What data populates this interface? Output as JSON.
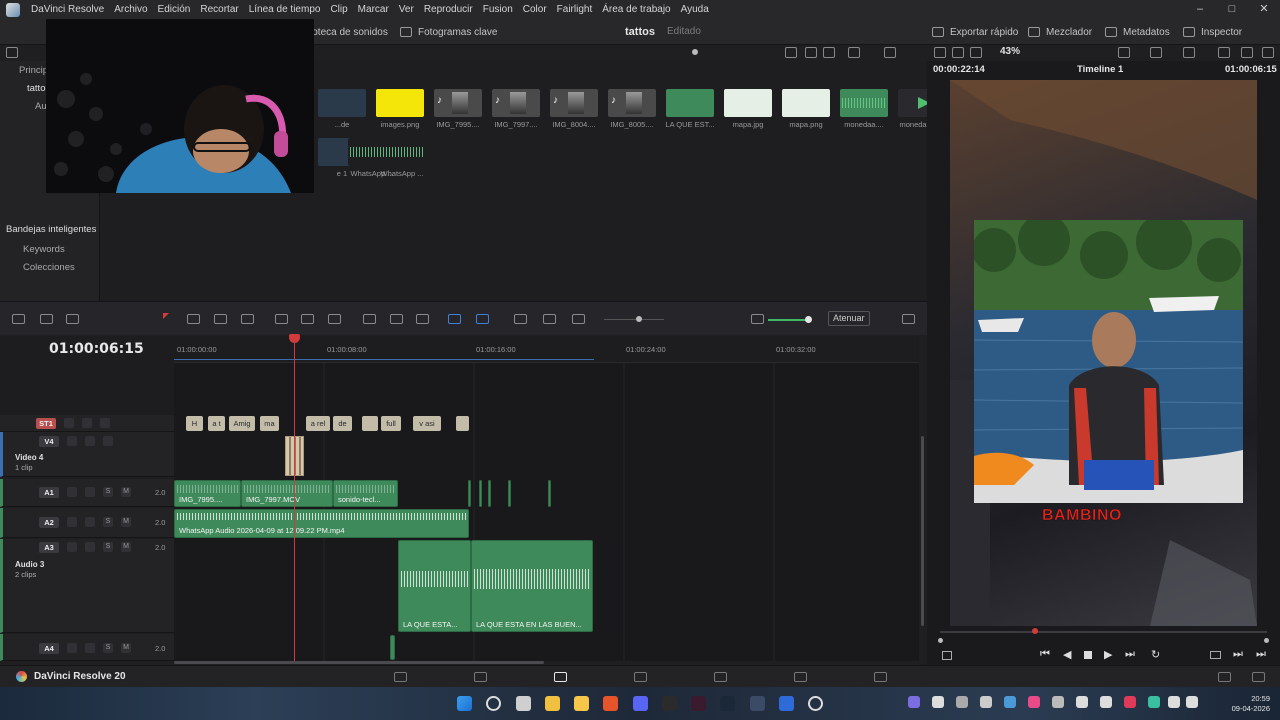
{
  "app": {
    "title": "DaVinci Resolve",
    "brand_footer": "DaVinci Resolve 20"
  },
  "menu": [
    "Archivo",
    "Edición",
    "Recortar",
    "Línea de tiempo",
    "Clip",
    "Marcar",
    "Ver",
    "Reproducir",
    "Fusion",
    "Color",
    "Fairlight",
    "Área de trabajo",
    "Ayuda"
  ],
  "toolbar": {
    "sound_library": "iblioteca de sonidos",
    "keyframes": "Fotogramas clave",
    "project_name": "tattos",
    "project_state": "Editado",
    "quick_export": "Exportar rápido",
    "mixer": "Mezclador",
    "metadata": "Metadatos",
    "inspector": "Inspector"
  },
  "viewer": {
    "zoom": "43%",
    "source_tc": "00:00:22:14",
    "timeline_name": "Timeline 1",
    "record_tc": "01:00:06:15",
    "overlay_text": "BAMBINO"
  },
  "media_left": {
    "principal": "Princip",
    "tattos": "tatto",
    "audio": "Au",
    "smart_bins": "Bandejas inteligentes",
    "keywords": "Keywords",
    "collections": "Colecciones"
  },
  "media_pool": {
    "row1": [
      {
        "label": "...de",
        "kind": "video"
      },
      {
        "label": "images.png",
        "kind": "yellow"
      },
      {
        "label": "IMG_7995....",
        "kind": "img"
      },
      {
        "label": "IMG_7997....",
        "kind": "img"
      },
      {
        "label": "IMG_8004....",
        "kind": "img"
      },
      {
        "label": "IMG_8005....",
        "kind": "img"
      },
      {
        "label": "LA QUE EST...",
        "kind": "green"
      },
      {
        "label": "mapa.jpg",
        "kind": "map"
      },
      {
        "label": "mapa.png",
        "kind": "map"
      },
      {
        "label": "monedaa....",
        "kind": "audio"
      },
      {
        "label": "moneda-fw....",
        "kind": "play"
      }
    ],
    "row2": [
      {
        "label": "e 1",
        "kind": "video"
      },
      {
        "label": "WhatsApp ...",
        "kind": "wave"
      },
      {
        "label": "WhatsApp ...",
        "kind": "wave"
      }
    ]
  },
  "timeline": {
    "timecode": "01:00:06:15",
    "attenuate_label": "Atenuar",
    "ruler": [
      "01:00:00:00",
      "01:00:08:00",
      "01:00:16:00",
      "01:00:24:00",
      "01:00:32:00"
    ],
    "subtitles": [
      "H",
      "a t",
      "Amig",
      "ma",
      "a rel",
      "de",
      "",
      "full",
      "v asi",
      ""
    ],
    "tracks": {
      "st1": "ST1",
      "v4": {
        "tag": "V4",
        "name": "Video 4",
        "clips": "1 clip"
      },
      "a1": {
        "tag": "A1",
        "ch": "2.0"
      },
      "a2": {
        "tag": "A2",
        "ch": "2.0"
      },
      "a3": {
        "tag": "A3",
        "ch": "2.0",
        "name": "Audio 3",
        "clips": "2 clips"
      },
      "a4": {
        "tag": "A4",
        "ch": "2.0"
      }
    },
    "clips": {
      "a1_1": "IMG_7995....",
      "a1_2": "IMG_7997.MOV",
      "a1_3": "sonido-tecl...",
      "a2_1": "WhatsApp Audio 2026-04-09 at 12.09.22 PM.mp4",
      "a3_1": "LA QUE ESTA...",
      "a3_2": "LA QUE ESTA EN LAS BUEN..."
    }
  },
  "taskbar": {
    "time": "20:59",
    "date": "09-04-2026"
  }
}
